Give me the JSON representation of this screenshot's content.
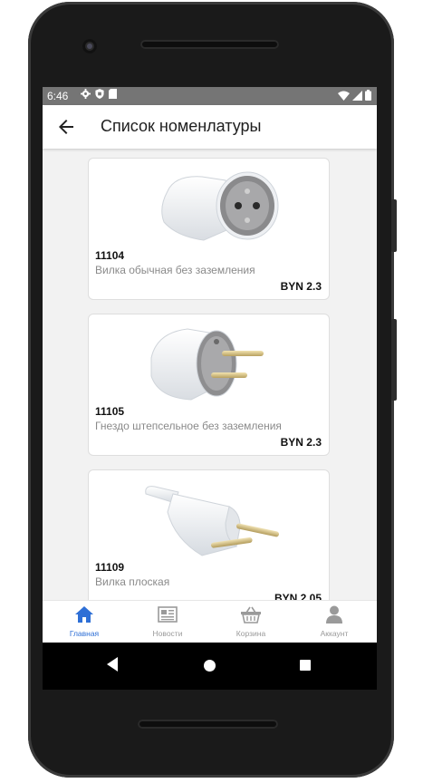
{
  "status_bar": {
    "time": "6:46",
    "left_icons": [
      "gear-icon",
      "shield-icon",
      "sd-card-icon"
    ],
    "right_icons": [
      "wifi-icon",
      "signal-icon",
      "battery-icon"
    ]
  },
  "app_bar": {
    "title": "Список номенлатуры",
    "back_icon": "arrow-left-icon"
  },
  "products": [
    {
      "code": "11104",
      "name": "Вилка обычная без заземления",
      "price": "BYN 2.3",
      "image": "grounded-plug-image"
    },
    {
      "code": "11105",
      "name": "Гнездо штепсельное без заземления",
      "price": "BYN 2.3",
      "image": "plug-with-pins-image"
    },
    {
      "code": "11109",
      "name": "Вилка плоская",
      "price": "BYN 2.05",
      "image": "flat-plug-image"
    }
  ],
  "bottom_nav": [
    {
      "label": "Главная",
      "icon": "home-icon",
      "active": true
    },
    {
      "label": "Новости",
      "icon": "newspaper-icon",
      "active": false
    },
    {
      "label": "Корзина",
      "icon": "basket-icon",
      "active": false
    },
    {
      "label": "Аккаунт",
      "icon": "person-icon",
      "active": false
    }
  ],
  "colors": {
    "accent": "#2e6fd6",
    "status_bar": "#757575",
    "content_bg": "#f2f2f2",
    "inactive_nav": "#9a9a9a"
  }
}
